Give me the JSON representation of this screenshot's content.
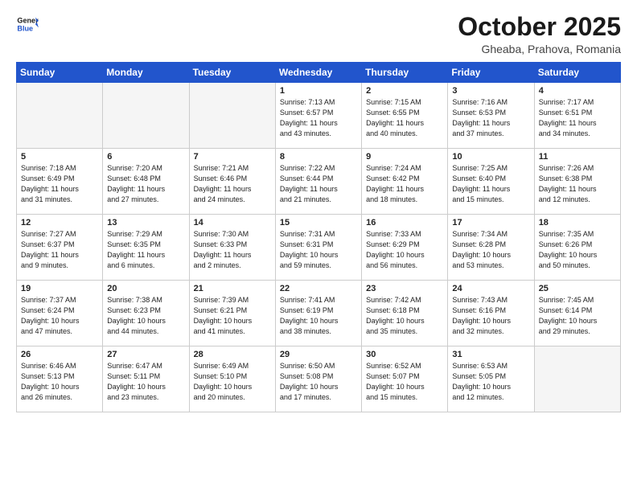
{
  "header": {
    "logo_line1": "General",
    "logo_line2": "Blue",
    "month": "October 2025",
    "location": "Gheaba, Prahova, Romania"
  },
  "days_of_week": [
    "Sunday",
    "Monday",
    "Tuesday",
    "Wednesday",
    "Thursday",
    "Friday",
    "Saturday"
  ],
  "weeks": [
    [
      {
        "day": "",
        "info": ""
      },
      {
        "day": "",
        "info": ""
      },
      {
        "day": "",
        "info": ""
      },
      {
        "day": "1",
        "info": "Sunrise: 7:13 AM\nSunset: 6:57 PM\nDaylight: 11 hours\nand 43 minutes."
      },
      {
        "day": "2",
        "info": "Sunrise: 7:15 AM\nSunset: 6:55 PM\nDaylight: 11 hours\nand 40 minutes."
      },
      {
        "day": "3",
        "info": "Sunrise: 7:16 AM\nSunset: 6:53 PM\nDaylight: 11 hours\nand 37 minutes."
      },
      {
        "day": "4",
        "info": "Sunrise: 7:17 AM\nSunset: 6:51 PM\nDaylight: 11 hours\nand 34 minutes."
      }
    ],
    [
      {
        "day": "5",
        "info": "Sunrise: 7:18 AM\nSunset: 6:49 PM\nDaylight: 11 hours\nand 31 minutes."
      },
      {
        "day": "6",
        "info": "Sunrise: 7:20 AM\nSunset: 6:48 PM\nDaylight: 11 hours\nand 27 minutes."
      },
      {
        "day": "7",
        "info": "Sunrise: 7:21 AM\nSunset: 6:46 PM\nDaylight: 11 hours\nand 24 minutes."
      },
      {
        "day": "8",
        "info": "Sunrise: 7:22 AM\nSunset: 6:44 PM\nDaylight: 11 hours\nand 21 minutes."
      },
      {
        "day": "9",
        "info": "Sunrise: 7:24 AM\nSunset: 6:42 PM\nDaylight: 11 hours\nand 18 minutes."
      },
      {
        "day": "10",
        "info": "Sunrise: 7:25 AM\nSunset: 6:40 PM\nDaylight: 11 hours\nand 15 minutes."
      },
      {
        "day": "11",
        "info": "Sunrise: 7:26 AM\nSunset: 6:38 PM\nDaylight: 11 hours\nand 12 minutes."
      }
    ],
    [
      {
        "day": "12",
        "info": "Sunrise: 7:27 AM\nSunset: 6:37 PM\nDaylight: 11 hours\nand 9 minutes."
      },
      {
        "day": "13",
        "info": "Sunrise: 7:29 AM\nSunset: 6:35 PM\nDaylight: 11 hours\nand 6 minutes."
      },
      {
        "day": "14",
        "info": "Sunrise: 7:30 AM\nSunset: 6:33 PM\nDaylight: 11 hours\nand 2 minutes."
      },
      {
        "day": "15",
        "info": "Sunrise: 7:31 AM\nSunset: 6:31 PM\nDaylight: 10 hours\nand 59 minutes."
      },
      {
        "day": "16",
        "info": "Sunrise: 7:33 AM\nSunset: 6:29 PM\nDaylight: 10 hours\nand 56 minutes."
      },
      {
        "day": "17",
        "info": "Sunrise: 7:34 AM\nSunset: 6:28 PM\nDaylight: 10 hours\nand 53 minutes."
      },
      {
        "day": "18",
        "info": "Sunrise: 7:35 AM\nSunset: 6:26 PM\nDaylight: 10 hours\nand 50 minutes."
      }
    ],
    [
      {
        "day": "19",
        "info": "Sunrise: 7:37 AM\nSunset: 6:24 PM\nDaylight: 10 hours\nand 47 minutes."
      },
      {
        "day": "20",
        "info": "Sunrise: 7:38 AM\nSunset: 6:23 PM\nDaylight: 10 hours\nand 44 minutes."
      },
      {
        "day": "21",
        "info": "Sunrise: 7:39 AM\nSunset: 6:21 PM\nDaylight: 10 hours\nand 41 minutes."
      },
      {
        "day": "22",
        "info": "Sunrise: 7:41 AM\nSunset: 6:19 PM\nDaylight: 10 hours\nand 38 minutes."
      },
      {
        "day": "23",
        "info": "Sunrise: 7:42 AM\nSunset: 6:18 PM\nDaylight: 10 hours\nand 35 minutes."
      },
      {
        "day": "24",
        "info": "Sunrise: 7:43 AM\nSunset: 6:16 PM\nDaylight: 10 hours\nand 32 minutes."
      },
      {
        "day": "25",
        "info": "Sunrise: 7:45 AM\nSunset: 6:14 PM\nDaylight: 10 hours\nand 29 minutes."
      }
    ],
    [
      {
        "day": "26",
        "info": "Sunrise: 6:46 AM\nSunset: 5:13 PM\nDaylight: 10 hours\nand 26 minutes."
      },
      {
        "day": "27",
        "info": "Sunrise: 6:47 AM\nSunset: 5:11 PM\nDaylight: 10 hours\nand 23 minutes."
      },
      {
        "day": "28",
        "info": "Sunrise: 6:49 AM\nSunset: 5:10 PM\nDaylight: 10 hours\nand 20 minutes."
      },
      {
        "day": "29",
        "info": "Sunrise: 6:50 AM\nSunset: 5:08 PM\nDaylight: 10 hours\nand 17 minutes."
      },
      {
        "day": "30",
        "info": "Sunrise: 6:52 AM\nSunset: 5:07 PM\nDaylight: 10 hours\nand 15 minutes."
      },
      {
        "day": "31",
        "info": "Sunrise: 6:53 AM\nSunset: 5:05 PM\nDaylight: 10 hours\nand 12 minutes."
      },
      {
        "day": "",
        "info": ""
      }
    ]
  ]
}
